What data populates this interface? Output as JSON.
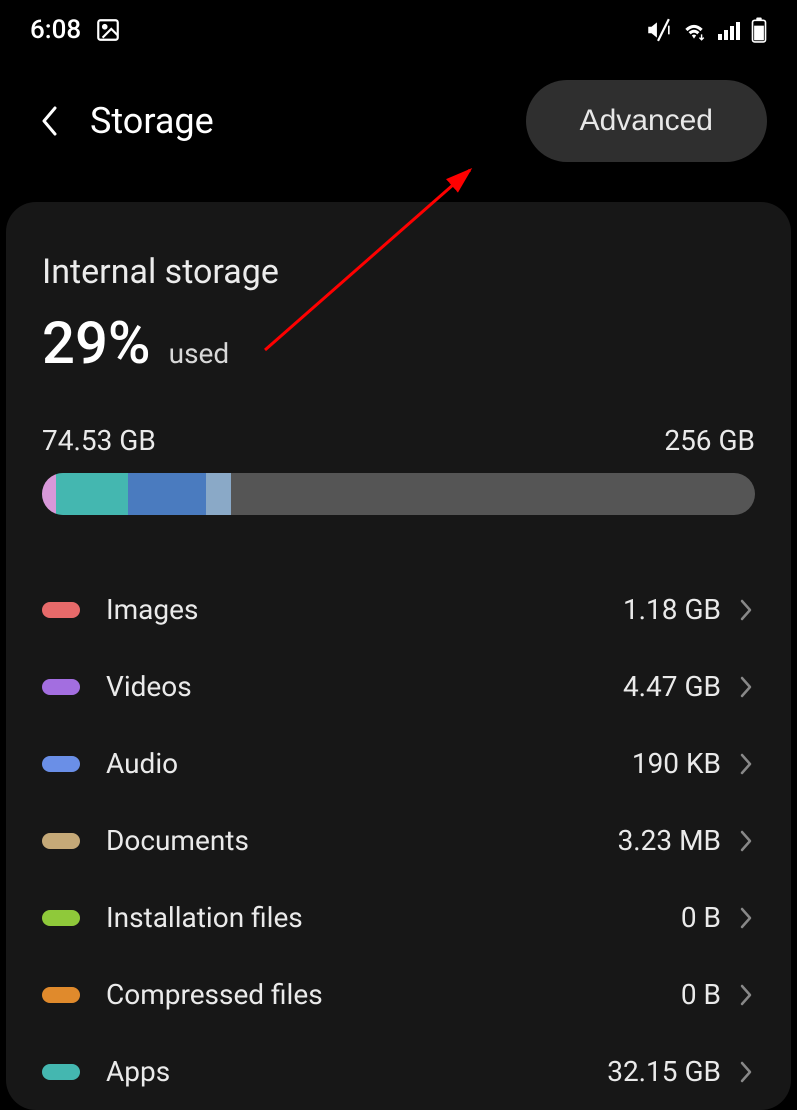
{
  "status": {
    "time": "6:08"
  },
  "header": {
    "title": "Storage",
    "advanced_label": "Advanced"
  },
  "storage": {
    "title": "Internal storage",
    "percent": "29%",
    "used_label": "used",
    "used_size": "74.53 GB",
    "total_size": "256 GB",
    "segments": [
      {
        "color": "#d898d9",
        "width": 2.0
      },
      {
        "color": "#44b7b0",
        "width": 10.0
      },
      {
        "color": "#4a7bbf",
        "width": 11.0
      },
      {
        "color": "#8aa9c7",
        "width": 3.5
      }
    ]
  },
  "categories": [
    {
      "name": "Images",
      "size": "1.18 GB",
      "color": "#e76a6a"
    },
    {
      "name": "Videos",
      "size": "4.47 GB",
      "color": "#a36ee0"
    },
    {
      "name": "Audio",
      "size": "190 KB",
      "color": "#6a8fe7"
    },
    {
      "name": "Documents",
      "size": "3.23 MB",
      "color": "#c5a978"
    },
    {
      "name": "Installation files",
      "size": "0 B",
      "color": "#8fc93a"
    },
    {
      "name": "Compressed files",
      "size": "0 B",
      "color": "#e08a2c"
    },
    {
      "name": "Apps",
      "size": "32.15 GB",
      "color": "#44b7b0"
    }
  ]
}
